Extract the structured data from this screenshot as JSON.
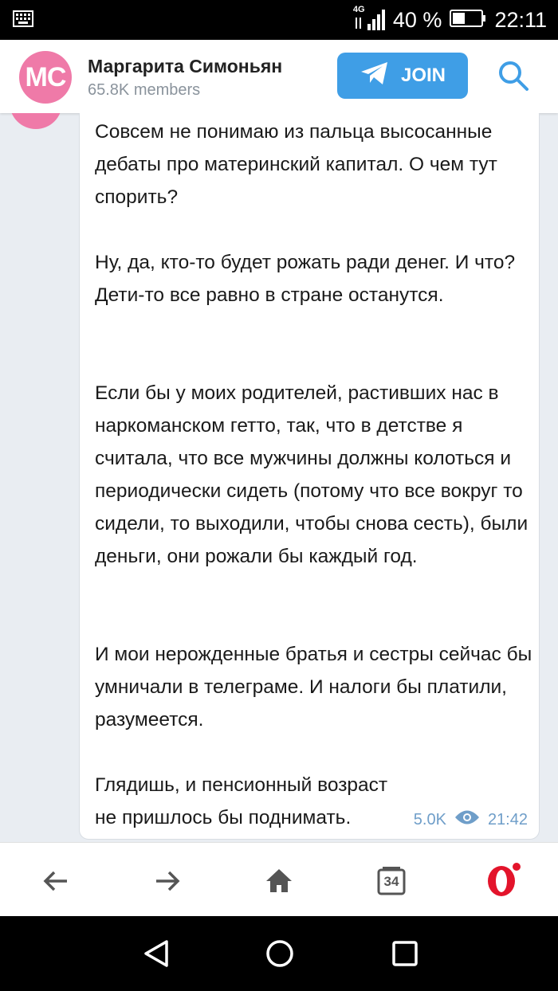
{
  "status_bar": {
    "network": "4G",
    "battery_percent": "40 %",
    "time": "22:11"
  },
  "header": {
    "avatar_initials": "MC",
    "channel_name": "Маргарита Симоньян",
    "members": "65.8K members",
    "join_label": "JOIN",
    "accent_color": "#3f9ee6"
  },
  "message": {
    "paragraphs": [
      "Совсем не понимаю из пальца высосанные дебаты про материнский капитал. О чем тут спорить?",
      "Ну, да, кто-то будет рожать ради денег. И что? Дети-то все равно в стране останутся.",
      "Если бы у моих родителей, растивших нас в наркоманском гетто, так, что в детстве я считала, что все мужчины должны колоться и периодически сидеть (потому что все вокруг то сидели, то выходили, чтобы снова сесть), были деньги, они рожали бы каждый год.",
      "И мои нерожденные братья и сестры сейчас бы умничали в телеграме. И налоги бы платили, разумеется.",
      "Глядишь, и пенсионный возраст не пришлось бы поднимать."
    ],
    "views": "5.0K",
    "time": "21:42"
  },
  "browser_bar": {
    "tabs_count": "34",
    "icons": [
      "back-arrow-icon",
      "forward-arrow-icon",
      "home-icon",
      "tabs-icon",
      "opera-icon"
    ]
  },
  "nav_bar": {
    "icons": [
      "back-triangle-icon",
      "home-circle-icon",
      "recents-square-icon"
    ]
  }
}
